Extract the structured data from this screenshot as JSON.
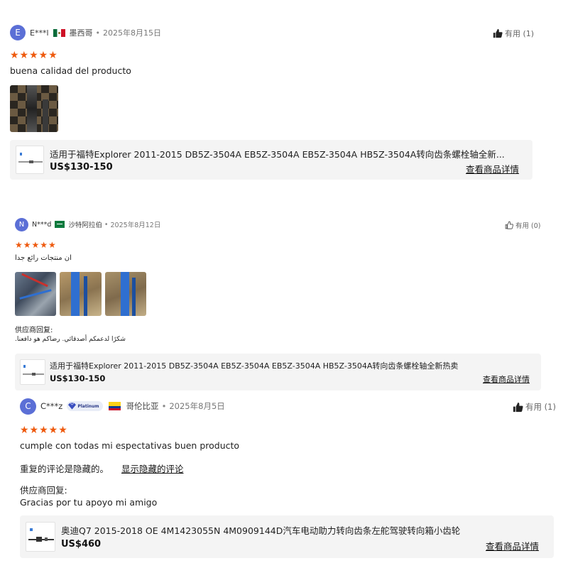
{
  "reviews": [
    {
      "avatar_letter": "E",
      "username": "E***l",
      "country": "墨西哥",
      "date": "2025年8月15日",
      "helpful": "有用 (1)",
      "stars": "★★★★★",
      "text": "buena calidad del producto",
      "product": {
        "title": "适用于福特Explorer 2011-2015 DB5Z-3504A EB5Z-3504A EB5Z-3504A HB5Z-3504A转向齿条螺栓轴全新...",
        "price": "US$130-150",
        "link": "查看商品详情"
      }
    },
    {
      "avatar_letter": "N",
      "username": "N***d",
      "country": "沙特阿拉伯",
      "date": "2025年8月12日",
      "helpful": "有用 (0)",
      "stars": "★★★★★",
      "text": "ان منتجات رائع جدا",
      "reply_label": "供应商回复:",
      "reply_text": "شكرًا لدعمكم أصدقائي. رضاكم هو دافعنا.",
      "product": {
        "title": "适用于福特Explorer 2011-2015 DB5Z-3504A EB5Z-3504A EB5Z-3504A HB5Z-3504A转向齿条螺栓轴全新热卖",
        "price": "US$130-150",
        "link": "查看商品详情"
      }
    },
    {
      "avatar_letter": "C",
      "username": "C***z",
      "badge": "Platinum",
      "country": "哥伦比亚",
      "date": "2025年8月5日",
      "helpful": "有用 (1)",
      "stars": "★★★★★",
      "text": "cumple con todas mi espectativas buen producto",
      "hidden_note": "重复的评论是隐藏的。",
      "show_hidden": "显示隐藏的评论",
      "reply_label": "供应商回复:",
      "reply_text": "Gracias por tu apoyo mi amigo",
      "product": {
        "title": "奥迪Q7 2015-2018 OE 4M1423055N 4M0909144D汽车电动助力转向齿条左舵驾驶转向箱小齿轮",
        "price": "US$460",
        "link": "查看商品详情"
      }
    }
  ],
  "colors": {
    "accent_star": "#ee5a0e",
    "avatar": "#5b6fd6",
    "badge_bg": "#e9edf7",
    "product_bg": "#f4f4f4"
  },
  "icons": [
    "thumbs-up-icon",
    "diamond-badge-icon",
    "flag-icon"
  ]
}
